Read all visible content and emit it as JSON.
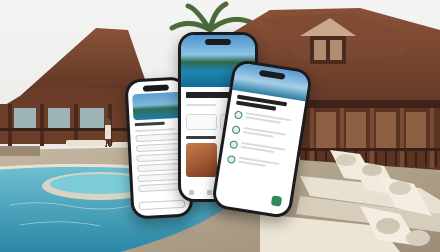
{
  "scene": {
    "kind": "hotel-resort-photo-with-phone-mockups",
    "phones": [
      {
        "name": "phone-chat-assistant"
      },
      {
        "name": "phone-welcome"
      },
      {
        "name": "phone-activity"
      }
    ],
    "palette": {
      "sky": "#eef0ef",
      "roof": "#7a4630",
      "wood": "#5a3322",
      "pool": "#3b9fb8",
      "deck": "#b7a893",
      "sunbed": "#f1ebdd",
      "accent": "#2f8a5b"
    }
  }
}
